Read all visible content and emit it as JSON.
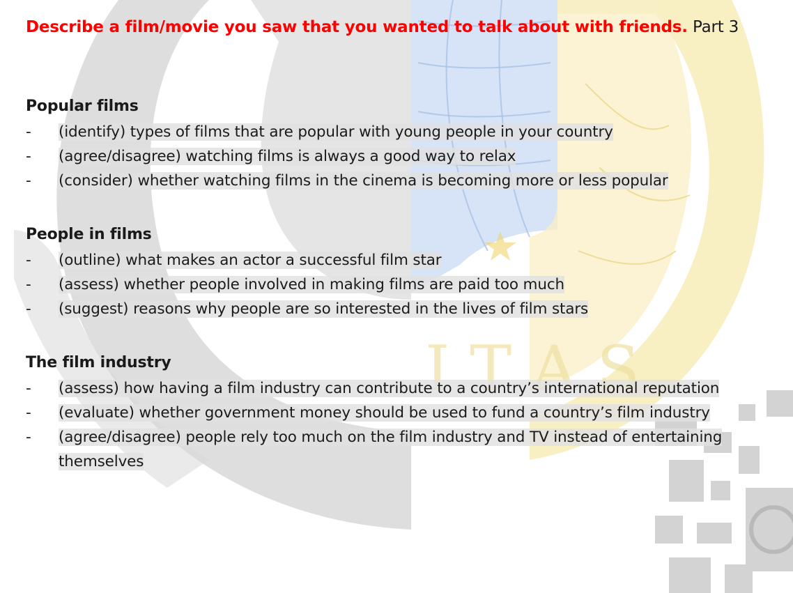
{
  "title": {
    "main": "Describe a film/movie you saw that you wanted to talk about with friends.",
    "part": "Part 3"
  },
  "sections": [
    {
      "heading": "Popular films",
      "items": [
        "(identify) types of films that are popular with young people in your country",
        "(agree/disagree) watching films is always a good way to relax",
        "(consider) whether watching films in the cinema is becoming more or less popular"
      ]
    },
    {
      "heading": "People in films",
      "items": [
        "(outline) what makes an actor a successful film star",
        "(assess) whether people involved in making films are paid too much",
        "(suggest) reasons why people are so interested in the lives of film stars"
      ]
    },
    {
      "heading": "The film industry",
      "items": [
        "(assess) how having a film industry can contribute to a country’s international reputation",
        "(evaluate) whether government money should be used to fund a country’s film industry",
        "(agree/disagree) people rely too much on the film industry and TV instead of entertaining themselves"
      ]
    }
  ],
  "bullet": "-",
  "colors": {
    "title_red": "#ff0000",
    "text": "#1a1a1a",
    "highlight": "#e1e1e1",
    "watermark_gray": "#bdbdbd",
    "watermark_blue": "#c9daf5",
    "watermark_yellow": "#f6e7a6"
  }
}
